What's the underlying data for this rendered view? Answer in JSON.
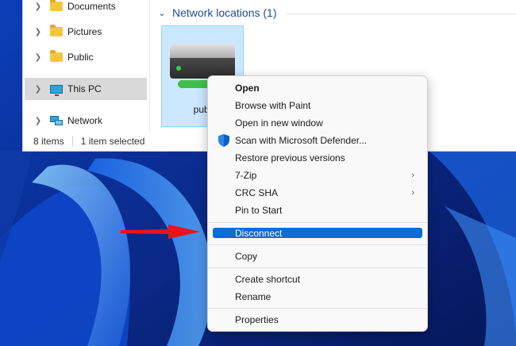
{
  "explorer": {
    "nav_items": [
      {
        "label": "Documents"
      },
      {
        "label": "Pictures"
      },
      {
        "label": "Public"
      },
      {
        "label": "This PC"
      },
      {
        "label": "Network"
      }
    ],
    "section_header": "Network locations (1)",
    "tile_label": "publ",
    "status": {
      "items": "8 items",
      "selected": "1 item selected"
    }
  },
  "context_menu": {
    "items": {
      "open": "Open",
      "browse_paint": "Browse with Paint",
      "open_new_window": "Open in new window",
      "scan_defender": "Scan with Microsoft Defender...",
      "restore_versions": "Restore previous versions",
      "seven_zip": "7-Zip",
      "crc_sha": "CRC SHA",
      "pin_start": "Pin to Start",
      "disconnect": "Disconnect",
      "copy": "Copy",
      "create_shortcut": "Create shortcut",
      "rename": "Rename",
      "properties": "Properties"
    },
    "submenu_glyph": "›",
    "highlighted": "Disconnect"
  },
  "colors": {
    "highlight": "#0a6cd6",
    "arrow": "#e8141b",
    "accent_header": "#1e4c96"
  }
}
